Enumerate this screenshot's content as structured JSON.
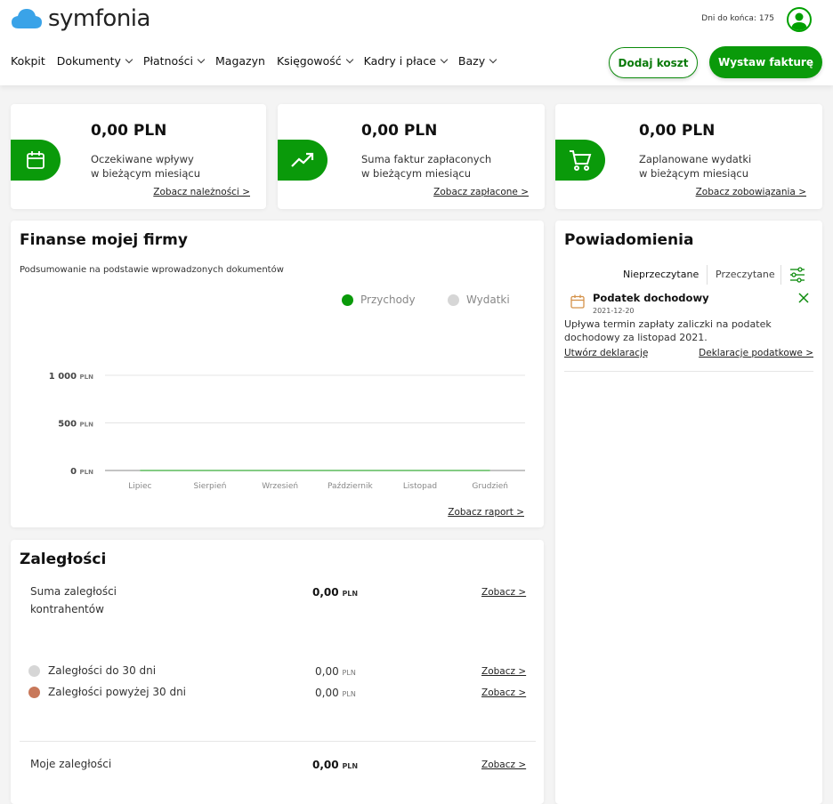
{
  "header": {
    "logo_text": "symfonia",
    "days_left": "Dni do końca: 175",
    "nav": [
      "Kokpit",
      "Dokumenty",
      "Płatności",
      "Magazyn",
      "Księgowość",
      "Kadry i płace",
      "Bazy"
    ],
    "nav_dropdown": [
      false,
      true,
      true,
      false,
      true,
      true,
      true
    ],
    "add_cost": "Dodaj koszt",
    "issue_invoice": "Wystaw fakturę"
  },
  "stats": [
    {
      "value": "0,00 PLN",
      "label1": "Oczekiwane wpływy",
      "label2": "w bieżącym miesiącu",
      "link": "Zobacz należności >",
      "icon": "calendar-icon"
    },
    {
      "value": "0,00 PLN",
      "label1": "Suma faktur zapłaconych",
      "label2": "w bieżącym miesiącu",
      "link": "Zobacz zapłacone >",
      "icon": "trending-up-icon"
    },
    {
      "value": "0,00 PLN",
      "label1": "Zaplanowane wydatki",
      "label2": "w bieżącym miesiącu",
      "link": "Zobacz zobowiązania >",
      "icon": "cart-icon"
    }
  ],
  "finance": {
    "title": "Finanse mojej firmy",
    "subtitle": "Podsumowanie na podstawie wprowadzonych dokumentów",
    "report_link": "Zobacz raport >"
  },
  "chart_data": {
    "type": "line",
    "categories": [
      "Lipiec",
      "Sierpień",
      "Wrzesień",
      "Październik",
      "Listopad",
      "Grudzień"
    ],
    "series": [
      {
        "name": "Przychody",
        "values": [
          0,
          0,
          0,
          0,
          0,
          0
        ],
        "color": "#0a9a0a"
      },
      {
        "name": "Wydatki",
        "values": [
          0,
          0,
          0,
          0,
          0,
          0
        ],
        "color": "#d6d6d6"
      }
    ],
    "yticks": [
      {
        "value": 0,
        "label": "0",
        "unit": "PLN"
      },
      {
        "value": 500,
        "label": "500",
        "unit": "PLN"
      },
      {
        "value": 1000,
        "label": "1 000",
        "unit": "PLN"
      }
    ],
    "ylim": [
      0,
      1000
    ],
    "legend": "top-right",
    "grid": true
  },
  "arrears": {
    "title": "Zaległości",
    "sum_label1": "Suma zaległości",
    "sum_label2": "kontrahentów",
    "sum_value": "0,00",
    "currency": "PLN",
    "see": "Zobacz >",
    "rows": [
      {
        "label": "Zaległości do 30 dni",
        "value": "0,00",
        "color": "#d6d6d6"
      },
      {
        "label": "Zaległości powyżej 30 dni",
        "value": "0,00",
        "color": "#c8785a"
      }
    ],
    "mine_label": "Moje zaległości",
    "mine_value": "0,00"
  },
  "notifications": {
    "title": "Powiadomienia",
    "tab_unread": "Nieprzeczytane",
    "tab_read": "Przeczytane",
    "item": {
      "title": "Podatek dochodowy",
      "date": "2021-12-20",
      "body": "Upływa termin zapłaty zaliczki na podatek dochodowy za listopad 2021.",
      "link1": "Utwórz deklarację",
      "link2": "Deklaracje podatkowe >"
    }
  }
}
